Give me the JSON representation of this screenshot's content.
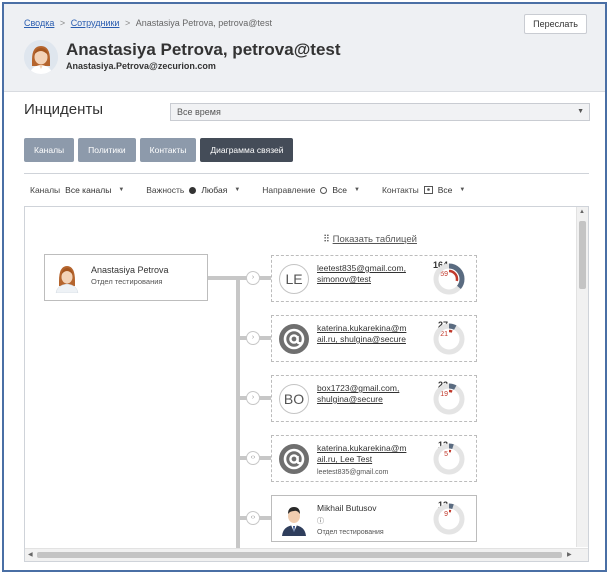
{
  "header": {
    "breadcrumb": {
      "item1": "Сводка",
      "item2": "Сотрудники",
      "current": "Anastasiya Petrova, petrova@test"
    },
    "forward_label": "Переслать",
    "title": "Anastasiya Petrova, petrova@test",
    "email": "Anastasiya.Petrova@zecurion.com"
  },
  "incidents": {
    "title": "Инциденты",
    "period": "Все время"
  },
  "tabs": [
    {
      "label": "Каналы"
    },
    {
      "label": "Политики"
    },
    {
      "label": "Контакты"
    },
    {
      "label": "Диаграмма связей"
    }
  ],
  "filters": {
    "channels": {
      "label": "Каналы",
      "value": "Все каналы"
    },
    "severity": {
      "label": "Важность",
      "value": "Любая"
    },
    "direction": {
      "label": "Направление",
      "value": "Все"
    },
    "contacts": {
      "label": "Контакты",
      "value": "Все"
    }
  },
  "diagram": {
    "show_table": "Показать таблицей",
    "source": {
      "name": "Anastasiya Petrova",
      "dept": "Отдел тестирования"
    },
    "contacts": [
      {
        "avatar": "LE",
        "line1": "leetest835@gmail.com,",
        "line2": "simonov@test",
        "sub": "",
        "total": "164",
        "red": "59",
        "fraction": 0.36
      },
      {
        "avatar": "@",
        "line1": "katerina.kukarekina@m",
        "line2": "ail.ru, shulgina@secure",
        "sub": "",
        "total": "27",
        "red": "21",
        "fraction": 0.08
      },
      {
        "avatar": "BO",
        "line1": "box1723@gmail.com,",
        "line2": "shulgina@secure",
        "sub": "",
        "total": "23",
        "red": "19",
        "fraction": 0.08
      },
      {
        "avatar": "@",
        "line1": "katerina.kukarekina@m",
        "line2": "ail.ru, Lee Test",
        "sub": "leetest835@gmail.com",
        "total": "13",
        "red": "5",
        "fraction": 0.05
      },
      {
        "avatar": "person",
        "line1": "Mikhail Butusov",
        "line2": "",
        "sub": "Отдел тестирования",
        "total": "13",
        "red": "9",
        "fraction": 0.05
      }
    ]
  },
  "colors": {
    "accent": "#2a5db0",
    "tab_active": "#444c58",
    "tab": "#8d9aab",
    "alert": "#c0392b",
    "gauge": "#5a6b80"
  }
}
